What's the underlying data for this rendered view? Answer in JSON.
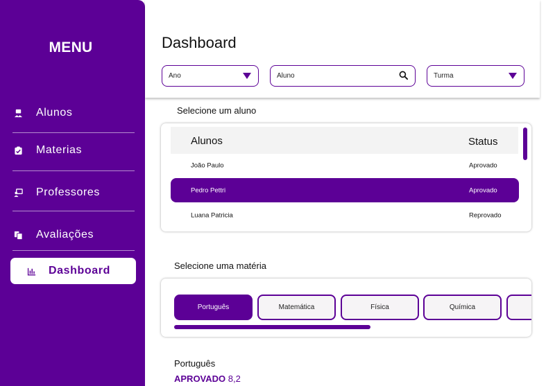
{
  "sidebar": {
    "title": "MENU",
    "items": [
      {
        "label": "Alunos",
        "icon": "student-icon"
      },
      {
        "label": "Materias",
        "icon": "clipboard-check-icon"
      },
      {
        "label": "Professores",
        "icon": "teacher-icon"
      },
      {
        "label": "Avaliações",
        "icon": "documents-icon"
      },
      {
        "label": "Dashboard",
        "icon": "bar-chart-icon",
        "active": true
      }
    ]
  },
  "header": {
    "title": "Dashboard",
    "filters": {
      "ano": "Ano",
      "aluno": "Aluno",
      "turma": "Turma"
    }
  },
  "students": {
    "section_label": "Selecione um aluno",
    "columns": [
      "Alunos",
      "Status"
    ],
    "rows": [
      {
        "name": "João Paulo",
        "status": "Aprovado"
      },
      {
        "name": "Pedro Pettri",
        "status": "Aprovado",
        "selected": true
      },
      {
        "name": "Luana Patricia",
        "status": "Reprovado"
      }
    ]
  },
  "subjects": {
    "section_label": "Selecione uma matéria",
    "tabs": [
      "Português",
      "Matemática",
      "Física",
      "Química"
    ],
    "active": "Português"
  },
  "result": {
    "subject": "Português",
    "status": "APROVADO",
    "grade": "8,2"
  },
  "colors": {
    "accent": "#5c0096",
    "background": "#ffffff",
    "row_header": "#f3f3f3"
  }
}
